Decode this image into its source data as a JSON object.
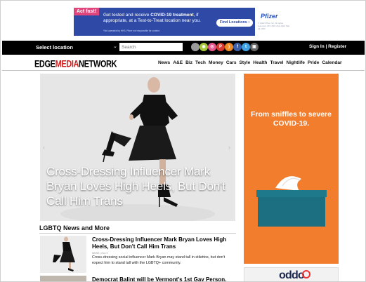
{
  "top_ad": {
    "flag": "Act fast!",
    "message_pre": "Get tested and receive ",
    "message_bold": "COVID-19 treatment",
    "message_post": ", if appropriate, at a Test-to-Treat location near you.",
    "fine_print": "*Not operated by HHS. Pfizer not responsible for content.",
    "button": "Find Locations",
    "brand": "Pfizer",
    "brand_fine": "© 2022 Pfizer Inc. All rights reserved. PP-UNP-USA-0114 Mar 22 2022"
  },
  "topbar": {
    "location_label": "Select location",
    "search_placeholder": "Search",
    "auth": "Sign In | Register",
    "social_icons": [
      "apple-icon",
      "android-icon",
      "dribbble-icon",
      "pinterest-icon",
      "rss-icon",
      "facebook-icon",
      "twitter-icon",
      "instagram-icon"
    ],
    "social_colors": [
      "#9a9a9a",
      "#a7c83a",
      "#e6568f",
      "#d83a32",
      "#f08a24",
      "#3b5ea8",
      "#3ea1e6",
      "#666666"
    ]
  },
  "logo": {
    "part1": "EDGE",
    "part2": "MEDIA",
    "part3": "NETWORK"
  },
  "nav": [
    "News",
    "A&E",
    "Biz",
    "Tech",
    "Money",
    "Cars",
    "Style",
    "Health",
    "Travel",
    "Nightlife",
    "Pride",
    "Calendar"
  ],
  "hero": {
    "caption": "Cross-Dressing Influencer Mark Bryan Loves High Heels, But Don't Call Him Trans"
  },
  "section": {
    "title": "LGBTQ News and More",
    "items": [
      {
        "title": "Cross-Dressing Influencer Mark Bryan Loves High Heels, But Don't Call Him Trans",
        "meta": "NEWS | Nov 9",
        "desc": "Cross-dressing social influencer Mark Bryan may stand tall in stilettos, but don't expect him to stand tall with the LGBTQ+ community."
      },
      {
        "title": "Democrat Balint will be Vermont's 1st Gay Person."
      }
    ]
  },
  "right_ad": {
    "text": "From sniffles to severe COVID-19."
  },
  "right_ad2": {
    "brand": "oddo"
  }
}
